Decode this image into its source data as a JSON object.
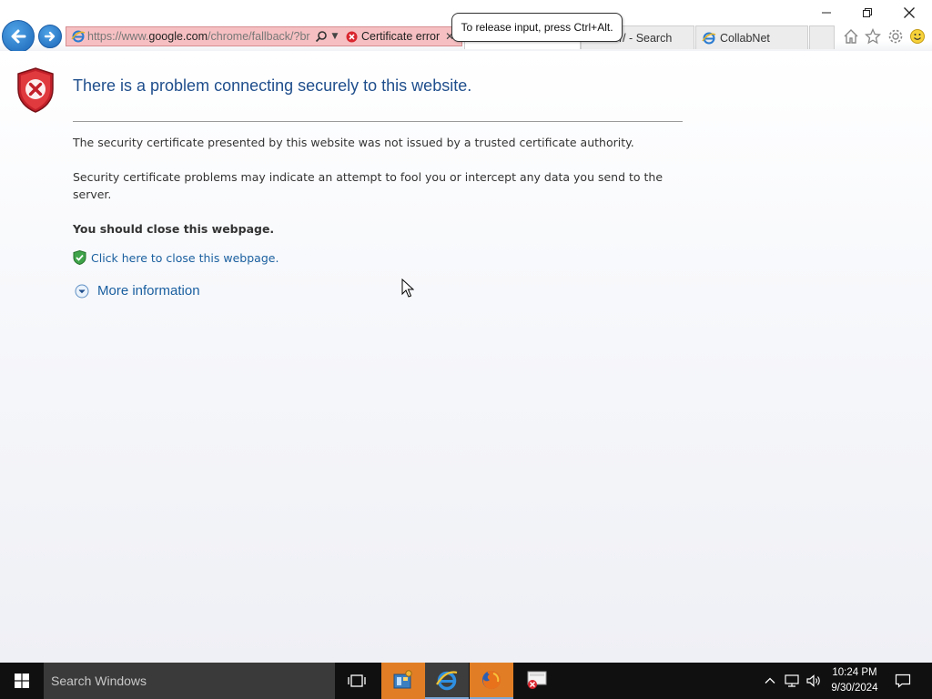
{
  "browser": {
    "address": {
      "url_prefix": "https://www.",
      "url_host": "google.com",
      "url_path": "/chrome/fallback/?br",
      "cert_error_label": "Certificate error"
    },
    "tabs": [
      {
        "label": ""
      },
      {
        "label": "er/ - Search"
      },
      {
        "label": "CollabNet"
      }
    ],
    "tooltip": "To release input, press Ctrl+Alt."
  },
  "page": {
    "title": "There is a problem connecting securely to this website.",
    "para1": "The security certificate presented by this website was not issued by a trusted certificate authority.",
    "para2": "Security certificate problems may indicate an attempt to fool you or intercept any data you send to the server.",
    "close_advice": "You should close this webpage.",
    "close_link": "Click here to close this webpage.",
    "more_info": "More information"
  },
  "taskbar": {
    "search_placeholder": "Search Windows",
    "time": "10:24 PM",
    "date": "9/30/2024"
  },
  "colors": {
    "title_blue": "#1f4e8c",
    "link_blue": "#1a5fa0",
    "cert_error_bg": "#f6c0c2",
    "taskbar_bg": "#101010"
  },
  "icons": [
    "back-icon",
    "forward-icon",
    "ie-page-icon",
    "search-icon",
    "cert-error-icon",
    "home-icon",
    "favorites-icon",
    "settings-icon",
    "smiley-icon",
    "shield-error-icon",
    "shield-check-icon",
    "expand-icon",
    "windows-logo-icon",
    "task-view-icon",
    "control-panel-icon",
    "ie-icon",
    "firefox-icon",
    "app-error-icon",
    "chevron-up-icon",
    "network-icon",
    "volume-icon",
    "notification-icon"
  ]
}
